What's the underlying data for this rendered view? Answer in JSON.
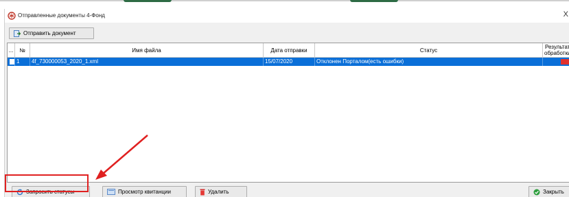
{
  "window": {
    "title": "Отправленные документы 4-Фонд",
    "close_glyph": "X"
  },
  "toolbar": {
    "send_document_label": "Отправить документ"
  },
  "table": {
    "columns": [
      "...",
      "№",
      "Имя файла",
      "Дата отправки",
      "Статус",
      "Результат обработки"
    ],
    "rows": [
      {
        "checked": false,
        "number": "1",
        "file_name": "4f_730000053_2020_1.xml",
        "sent_date": "15/07/2020",
        "status": "Отклонен Порталом(есть ошибки)",
        "result_color": "#e0312e"
      }
    ]
  },
  "bottom_buttons": {
    "request_statuses_label": "Запросить статусы",
    "view_receipts_label": "Просмотр квитанции",
    "delete_label": "Удалить",
    "close_label": "Закрыть"
  },
  "annotation": {
    "highlight_color": "#e02020"
  },
  "colors": {
    "selected_row": "#0a6fd8",
    "dialog_bg": "#f0f0f0"
  }
}
